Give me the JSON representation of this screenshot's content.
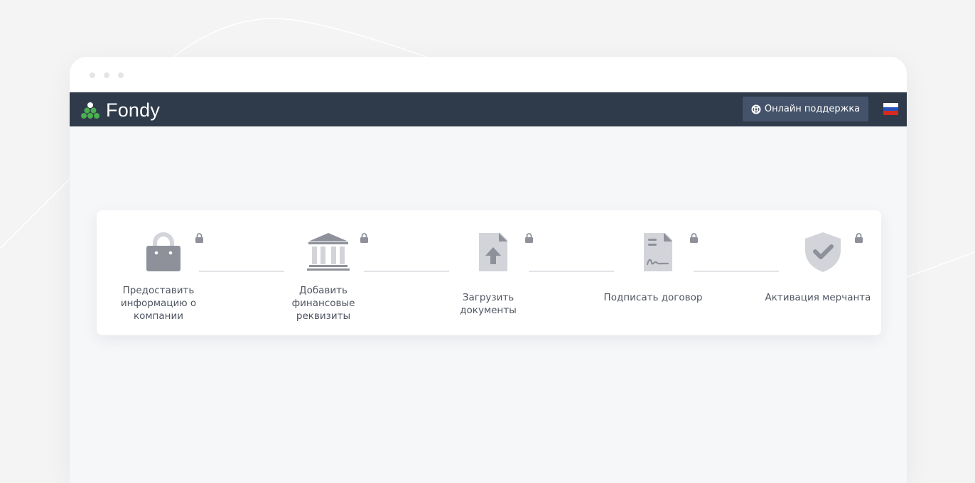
{
  "app": {
    "logo_text": "Fondy",
    "support_button_label": "Онлайн поддержка",
    "language_flag": "flag-ru-icon"
  },
  "colors": {
    "topbar": "#2f3a4a",
    "support_button": "#45536a",
    "logo_green": "#4caf50",
    "icon_gray": "#8e919a",
    "icon_light": "#c9cbd1"
  },
  "steps": [
    {
      "label": "Предоставить информацию о компании",
      "icon": "shopping-bag-icon",
      "locked": true
    },
    {
      "label": "Добавить финансовые реквизиты",
      "icon": "bank-icon",
      "locked": true
    },
    {
      "label": "Загрузить документы",
      "icon": "upload-document-icon",
      "locked": true
    },
    {
      "label": "Подписать договор",
      "icon": "signed-contract-icon",
      "locked": true
    },
    {
      "label": "Активация мерчанта",
      "icon": "shield-check-icon",
      "locked": true
    }
  ]
}
